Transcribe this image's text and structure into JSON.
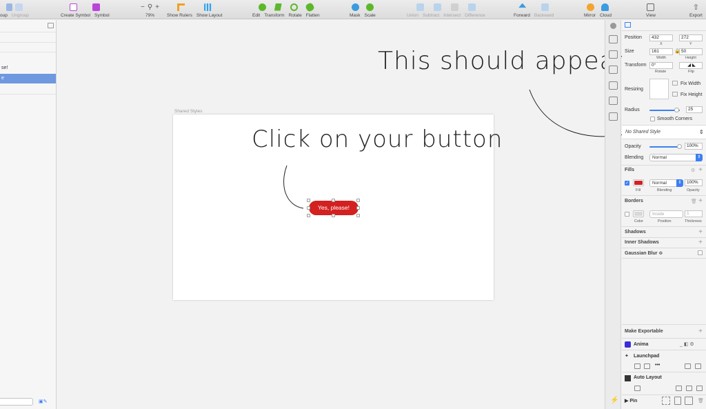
{
  "colors": {
    "accent": "#3d7ff2",
    "selection": "#6e98df",
    "button_fill": "#d32020",
    "symbol_purple": "#b946d8",
    "shape_green": "#5cb82a"
  },
  "toolbar": {
    "group": {
      "labels": [
        "oup",
        "Ungroup"
      ]
    },
    "symbol": {
      "create_label": "Create Symbol",
      "symbol_label": "Symbol"
    },
    "zoom": {
      "minus": "−",
      "plus": "+",
      "value": "79%"
    },
    "rulers_label": "Show Rulers",
    "layout_label": "Show Layout",
    "edit": [
      "Edit",
      "Transform",
      "Rotate",
      "Flatten"
    ],
    "mask": [
      "Mask",
      "Scale"
    ],
    "boolean": [
      "Union",
      "Subtract",
      "Intersect",
      "Difference"
    ],
    "arrange": [
      "Forward",
      "Backward"
    ],
    "cloud": [
      "Mirror",
      "Cloud"
    ],
    "view_label": "View",
    "export_label": "Export"
  },
  "layers": {
    "item_1": "se!",
    "item_selected": "e"
  },
  "canvas": {
    "artboard_label": "Shared Styles",
    "annotation_top": "This should appear",
    "annotation_mid": "Click on your button",
    "button_label": "Yes, please!"
  },
  "inspector": {
    "position": {
      "label": "Position",
      "x": "432",
      "y": "272",
      "x_sub": "X",
      "y_sub": "Y"
    },
    "size": {
      "label": "Size",
      "w": "161",
      "h": "50",
      "w_sub": "Width",
      "h_sub": "Height"
    },
    "transform": {
      "label": "Transform",
      "rotate": "0°",
      "rotate_sub": "Rotate",
      "flip_sub": "Flip"
    },
    "resizing": {
      "label": "Resizing",
      "fix_width": "Fix Width",
      "fix_height": "Fix Height"
    },
    "radius": {
      "label": "Radius",
      "value": "25",
      "smooth": "Smooth Corners",
      "level": 0.9
    },
    "shared_style": "No Shared Style",
    "opacity": {
      "label": "Opacity",
      "value": "100%",
      "level": 1.0
    },
    "blending": {
      "label": "Blending",
      "value": "Normal"
    },
    "fills": {
      "title": "Fills",
      "blend": "Normal",
      "opacity": "100%",
      "sub_fill": "Fill",
      "sub_blend": "Blending",
      "sub_opacity": "Opacity"
    },
    "borders": {
      "title": "Borders",
      "position": "Inside",
      "thickness": "1",
      "sub_color": "Color",
      "sub_position": "Position",
      "sub_thickness": "Thickness"
    },
    "shadows": "Shadows",
    "inner_shadows": "Inner Shadows",
    "gaussian": "Gaussian Blur ≎",
    "make_exportable": "Make Exportable",
    "anima": "Anima",
    "launchpad": "Launchpad",
    "auto_layout": "Auto Layout",
    "pin": "▶ Pin",
    "plus": "+"
  }
}
